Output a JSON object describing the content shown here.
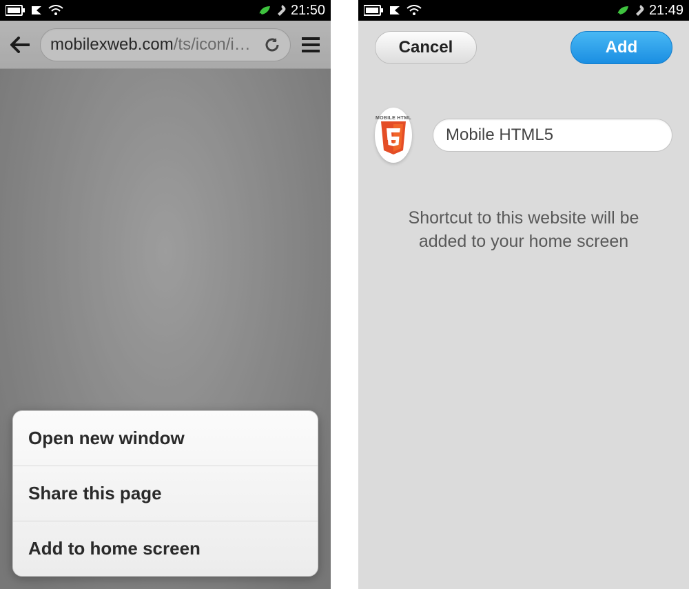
{
  "left": {
    "status": {
      "time": "21:50"
    },
    "url": {
      "domain": "mobilexweb.com",
      "path": "/ts/icon/i…"
    },
    "menu": {
      "items": [
        {
          "label": "Open new window"
        },
        {
          "label": "Share this page"
        },
        {
          "label": "Add to home screen"
        }
      ]
    }
  },
  "right": {
    "status": {
      "time": "21:49"
    },
    "header": {
      "cancel": "Cancel",
      "add": "Add"
    },
    "shortcut": {
      "icon_caption": "MOBILE HTML",
      "title": "Mobile HTML5",
      "hint": "Shortcut to this website will be added to your home screen"
    }
  }
}
